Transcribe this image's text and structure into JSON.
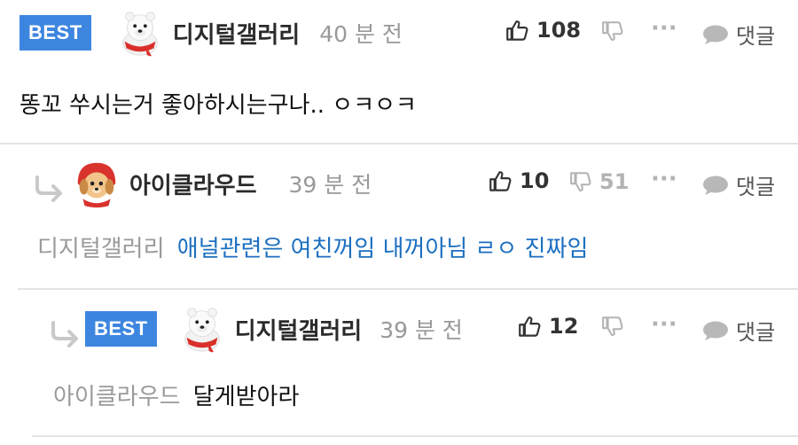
{
  "comments": [
    {
      "badge": "BEST",
      "nickname": "디지털갤러리",
      "avatar": "polar-bear-avatar",
      "time": "40 분 전",
      "likes": "108",
      "dislikes": "",
      "more": "···",
      "reply_label": "댓글",
      "text": "똥꼬 쑤시는거 좋아하시는구나.. ㅇㅋㅇㅋ"
    },
    {
      "badge": "",
      "nickname": "아이클라우드",
      "avatar": "puppy-avatar",
      "time": "39 분 전",
      "likes": "10",
      "dislikes": "51",
      "more": "···",
      "reply_label": "댓글",
      "mention": "디지털갤러리",
      "text": "애널관련은 여친꺼임 내꺼아님 ㄹㅇ 진짜임"
    },
    {
      "badge": "BEST",
      "nickname": "디지털갤러리",
      "avatar": "polar-bear-avatar",
      "time": "39 분 전",
      "likes": "12",
      "dislikes": "",
      "more": "···",
      "reply_label": "댓글",
      "mention": "아이클라우드",
      "text": "달게받아라"
    }
  ],
  "colors": {
    "best_badge": "#3d86e0",
    "link_blue": "#1c6fc0",
    "muted": "#999999"
  }
}
